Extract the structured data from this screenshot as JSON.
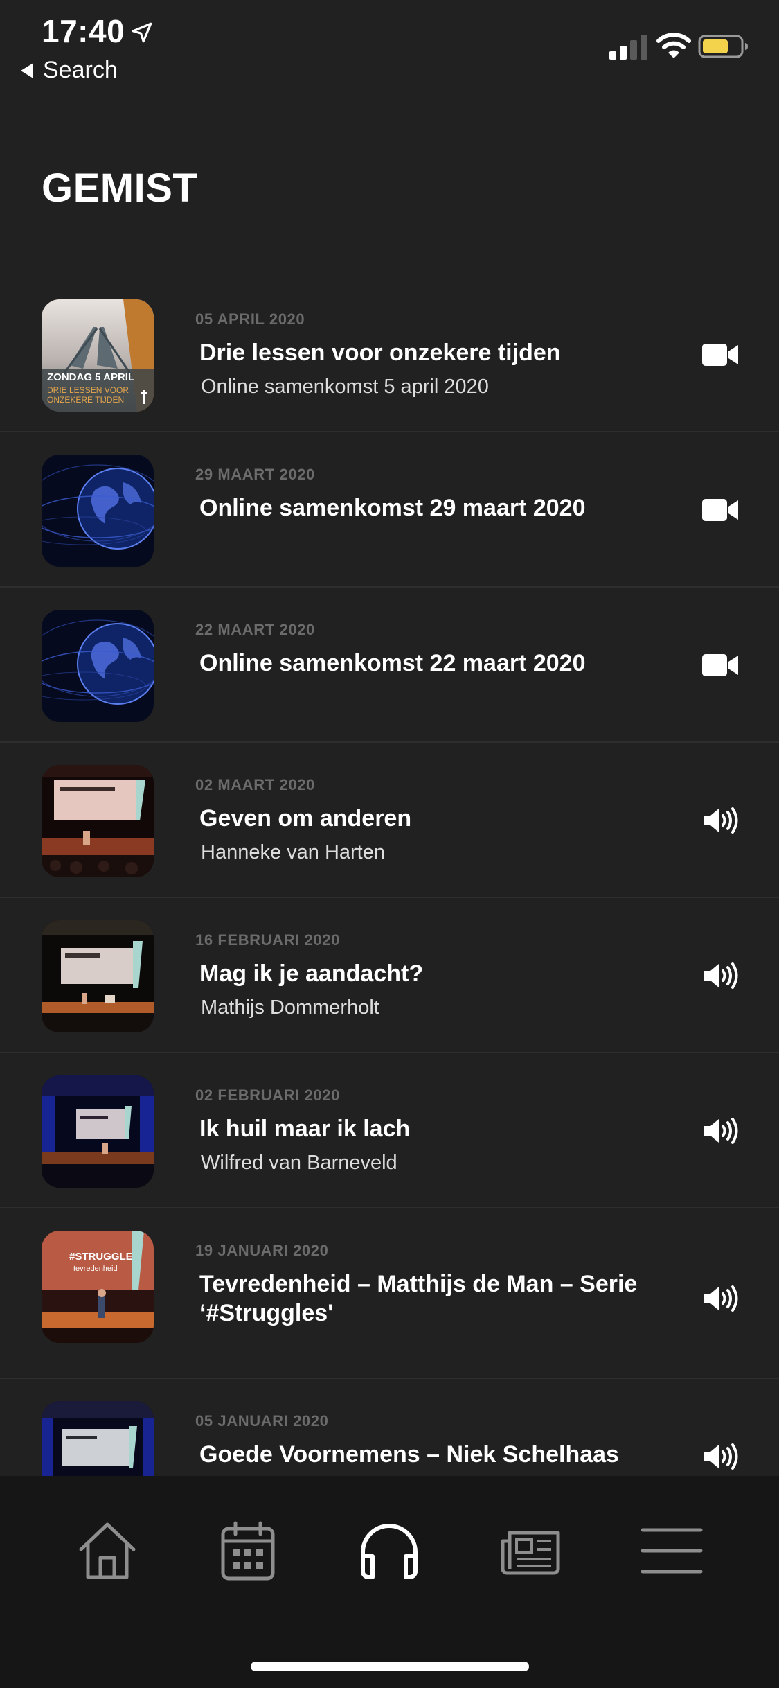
{
  "status_bar": {
    "time": "17:40",
    "back_label": "Search"
  },
  "page": {
    "title": "GEMIST"
  },
  "items": [
    {
      "date": "05 APRIL 2020",
      "title": "Drie lessen voor onzekere tijden",
      "subtitle": "Online samenkomst 5 april 2020",
      "media": "video-icon",
      "thumb_text": [
        "ZONDAG 5 APRIL",
        "DRIE LESSEN VOOR",
        "ONZEKERE TIJDEN"
      ]
    },
    {
      "date": "29 MAART 2020",
      "title": "Online samenkomst 29 maart 2020",
      "subtitle": "",
      "media": "video-icon"
    },
    {
      "date": "22 MAART 2020",
      "title": "Online samenkomst 22 maart 2020",
      "subtitle": "",
      "media": "video-icon"
    },
    {
      "date": "02 MAART 2020",
      "title": "Geven om anderen",
      "subtitle": "Hanneke van Harten",
      "media": "speaker-icon"
    },
    {
      "date": "16 FEBRUARI 2020",
      "title": "Mag ik je aandacht?",
      "subtitle": "Mathijs Dommerholt",
      "media": "speaker-icon"
    },
    {
      "date": "02 FEBRUARI 2020",
      "title": "Ik huil maar ik lach",
      "subtitle": "Wilfred van Barneveld",
      "media": "speaker-icon"
    },
    {
      "date": "19 JANUARI 2020",
      "title": "Tevredenheid – Matthijs de Man – Serie ‘#Struggles'",
      "subtitle": "",
      "media": "speaker-icon",
      "thumb_text": [
        "#STRUGGLE",
        "tevredenheid"
      ]
    },
    {
      "date": "05 JANUARI 2020",
      "title": "Goede Voornemens – Niek Schelhaas",
      "subtitle": "",
      "media": "speaker-icon"
    }
  ],
  "tab_bar": {
    "tabs": [
      "home-icon",
      "calendar-icon",
      "headphones-icon",
      "news-icon",
      "menu-icon"
    ],
    "active": "headphones-icon"
  },
  "colors": {
    "background": "#212121",
    "tab_bar": "#161616",
    "date_text": "#6b6b6b",
    "battery_fill": "#f2d34b"
  }
}
